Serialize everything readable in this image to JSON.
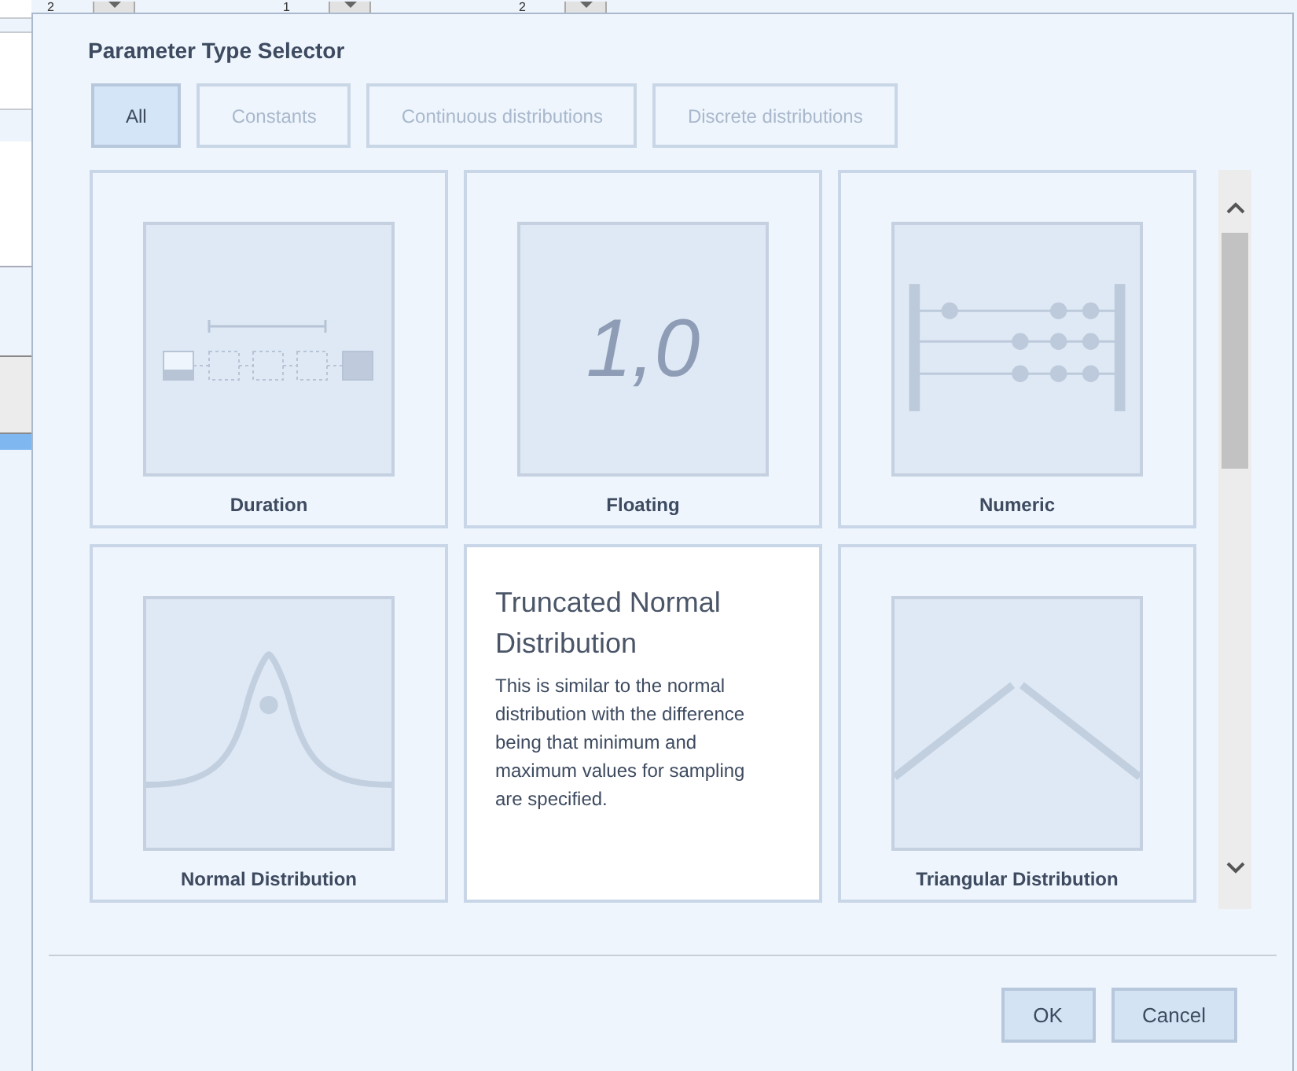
{
  "background": {
    "spinners": [
      "2",
      "1",
      "2"
    ]
  },
  "dialog": {
    "title": "Parameter Type Selector",
    "filters": [
      {
        "label": "All",
        "selected": true
      },
      {
        "label": "Constants",
        "selected": false
      },
      {
        "label": "Continuous distributions",
        "selected": false
      },
      {
        "label": "Discrete distributions",
        "selected": false
      }
    ],
    "tiles": [
      {
        "kind": "image",
        "label": "Duration"
      },
      {
        "kind": "image",
        "label": "Floating",
        "illustration_text": "1,0"
      },
      {
        "kind": "image",
        "label": "Numeric"
      },
      {
        "kind": "image",
        "label": "Normal Distribution"
      },
      {
        "kind": "info",
        "title": "Truncated Normal Distribution",
        "description": "This is similar to the normal distribution with the difference being that minimum and maximum values for sampling are specified."
      },
      {
        "kind": "image",
        "label": "Triangular Distribution"
      }
    ],
    "buttons": [
      "OK",
      "Cancel"
    ]
  }
}
